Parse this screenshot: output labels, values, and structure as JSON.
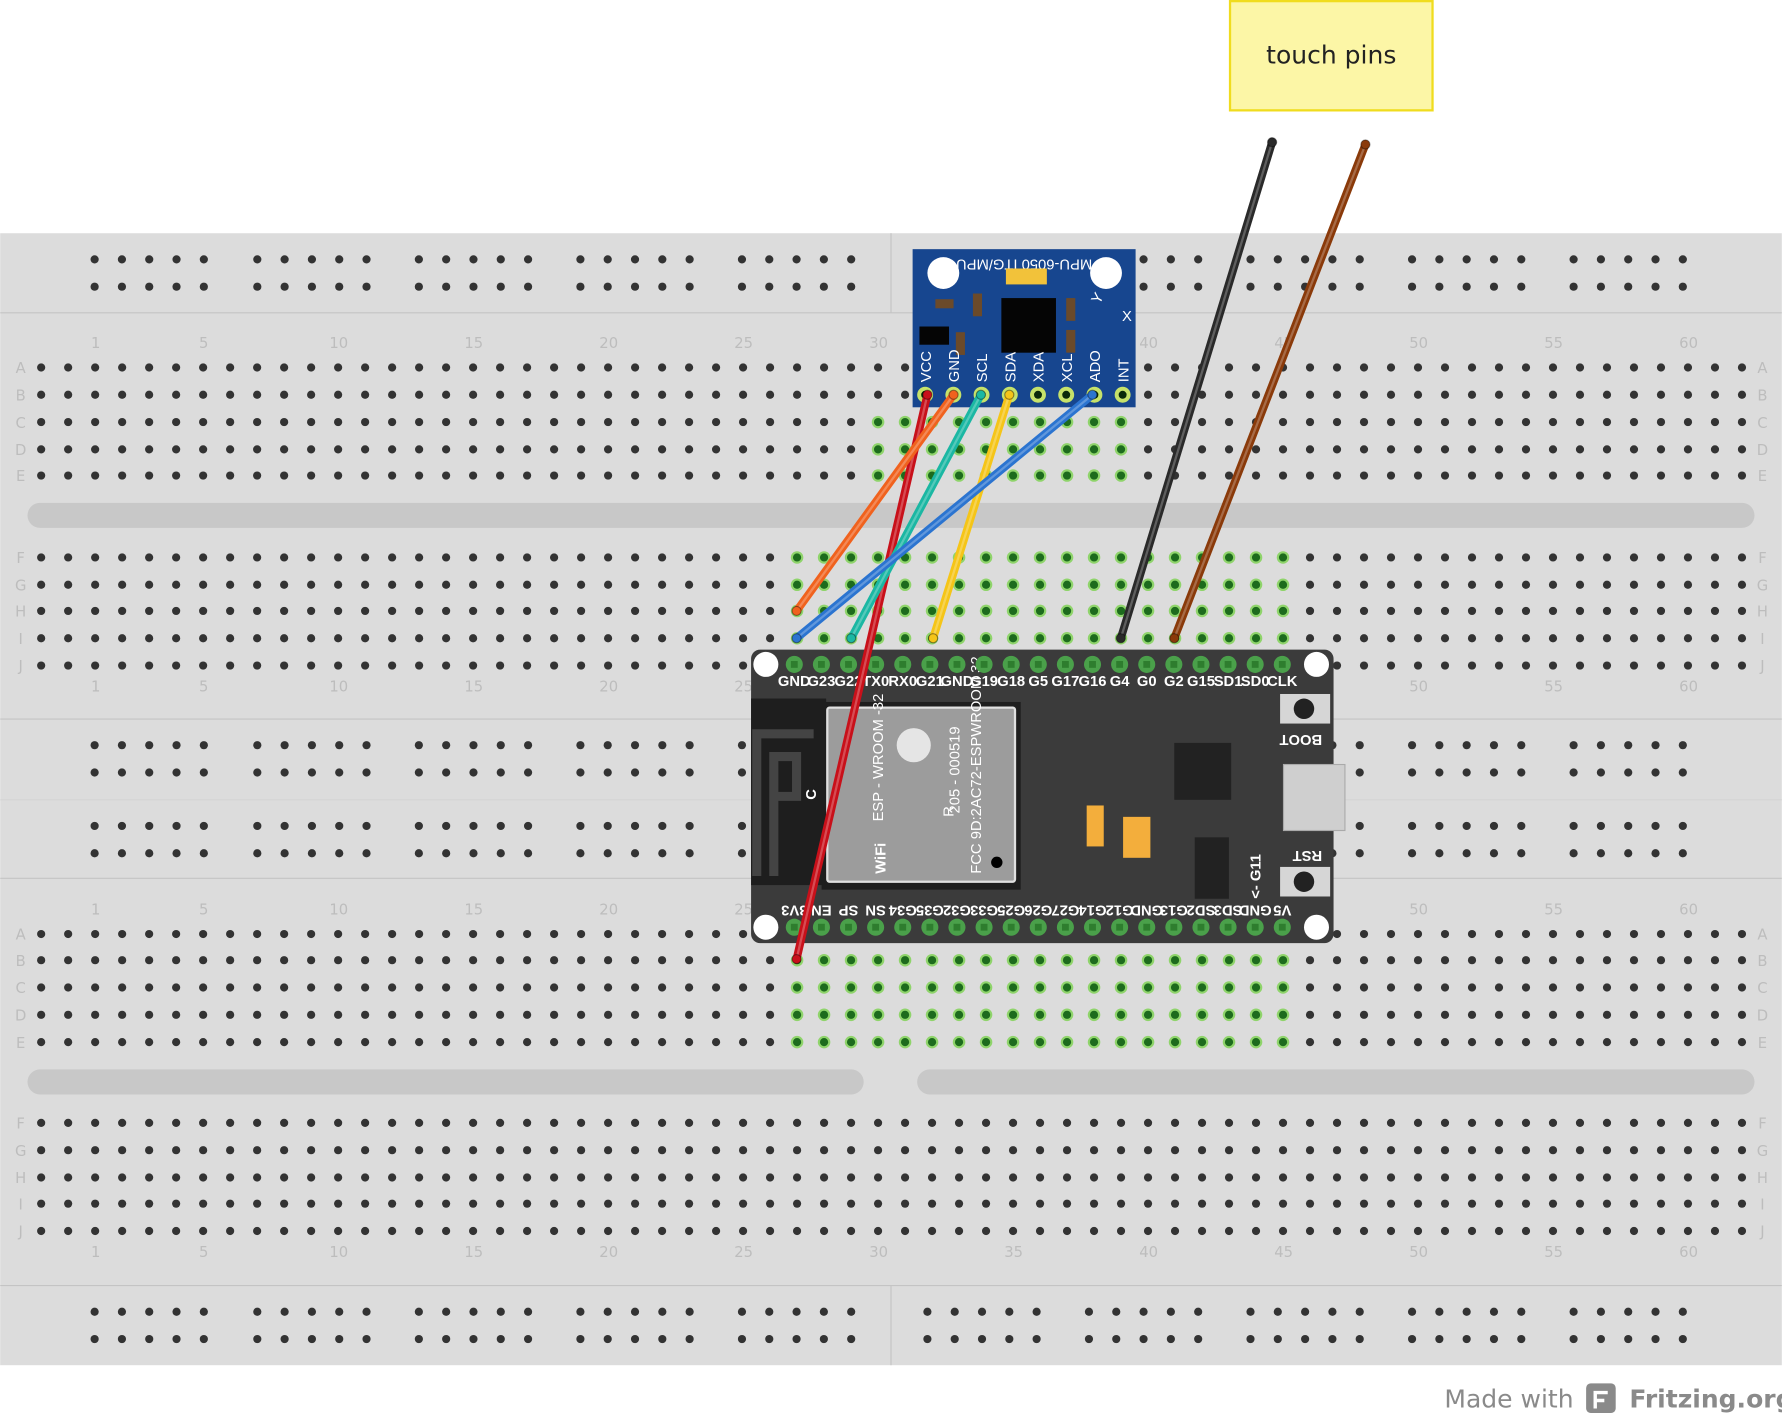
{
  "note": {
    "text": "touch pins"
  },
  "breadboard": {
    "row_letters_top": [
      "A",
      "B",
      "C",
      "D",
      "E"
    ],
    "row_letters_bottom": [
      "F",
      "G",
      "H",
      "I",
      "J"
    ],
    "column_numbers": [
      "1",
      "5",
      "10",
      "15",
      "20",
      "25",
      "30",
      "35",
      "40",
      "45",
      "50",
      "55",
      "60"
    ]
  },
  "mpu": {
    "title": "MPU-6050 ITG/MPU",
    "pins": [
      "VCC",
      "GND",
      "SCL",
      "SDA",
      "XDA",
      "XCL",
      "ADO",
      "INT"
    ],
    "axis_y": "Y",
    "axis_x": "X"
  },
  "esp32": {
    "top_pins": [
      "GND",
      "G23",
      "G22",
      "TX0",
      "RX0",
      "G21",
      "GND",
      "G19",
      "G18",
      "G5",
      "G17",
      "G16",
      "G4",
      "G0",
      "G2",
      "G15",
      "SD1",
      "SD0",
      "CLK"
    ],
    "bottom_pins": [
      "3V3",
      "EN",
      "SP",
      "SN",
      "G34",
      "G35",
      "G32",
      "G33",
      "G25",
      "G26",
      "G27",
      "G14",
      "G12",
      "GND",
      "G13",
      "SD2",
      "SD3",
      "GND",
      "V5"
    ],
    "module_text": [
      "ESP - WROOM -32",
      "205 - 000519",
      "FCC 9D:2AC72-ESPWROOM 32"
    ],
    "boot_label": "BOOT",
    "rst_label": "RST",
    "g11_label": "<- G11",
    "c_label": "C",
    "wifi_label": "WiFi",
    "r_label": "R"
  },
  "wires": [
    {
      "name": "red-wire",
      "color": "#c8101a"
    },
    {
      "name": "orange-wire",
      "color": "#f0621e"
    },
    {
      "name": "teal-wire",
      "color": "#1bb7a3"
    },
    {
      "name": "yellow-wire",
      "color": "#f5c518"
    },
    {
      "name": "blue-wire",
      "color": "#2b74d0"
    },
    {
      "name": "black-wire",
      "color": "#2a2a2a"
    },
    {
      "name": "brown-wire",
      "color": "#8a3a0a"
    }
  ],
  "footer": {
    "made_with": "Made with",
    "brand": "Fritzing.org"
  }
}
